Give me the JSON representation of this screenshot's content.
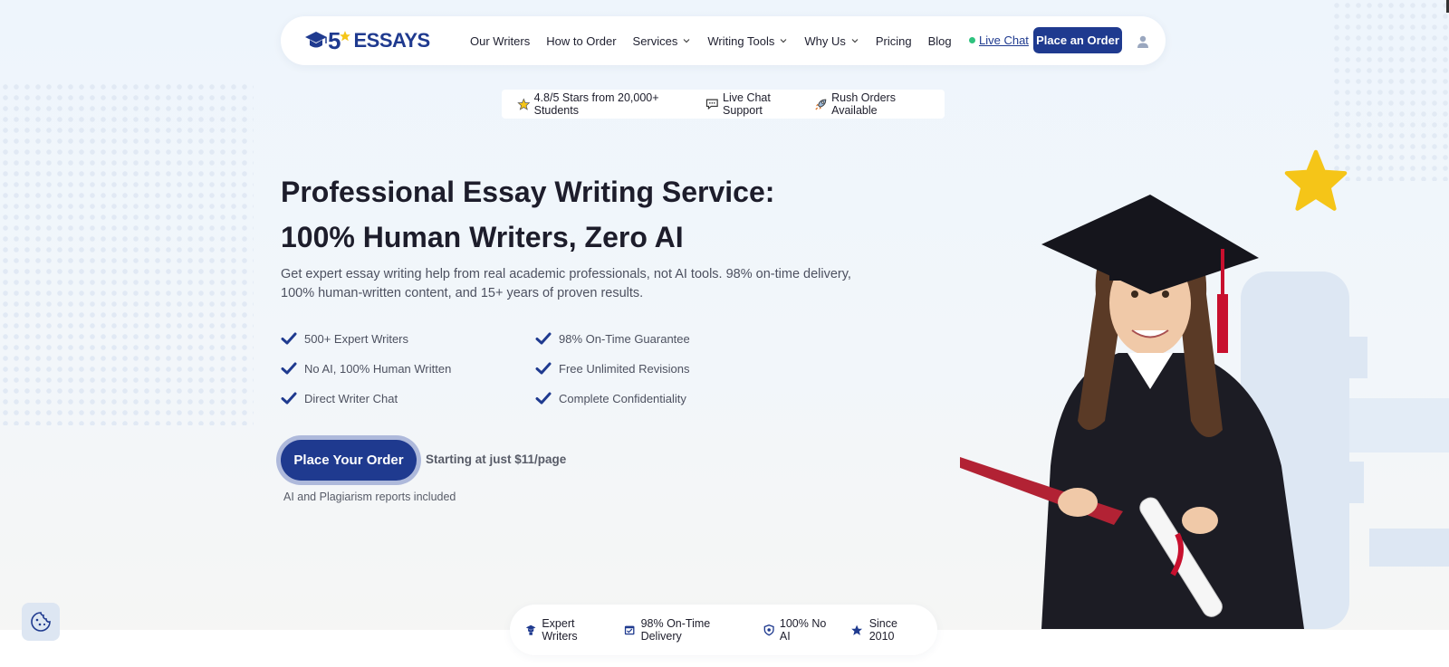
{
  "header": {
    "logo_number": "5",
    "logo_text": "ESSAYS",
    "nav": [
      {
        "label": "Our Writers",
        "dropdown": false
      },
      {
        "label": "How to Order",
        "dropdown": false
      },
      {
        "label": "Services",
        "dropdown": true
      },
      {
        "label": "Writing Tools",
        "dropdown": true
      },
      {
        "label": "Why Us",
        "dropdown": true
      },
      {
        "label": "Pricing",
        "dropdown": false
      },
      {
        "label": "Blog",
        "dropdown": false
      }
    ],
    "live_chat": "Live Chat",
    "order_button": "Place an Order"
  },
  "trust_bar": [
    {
      "icon": "star-icon",
      "text": "4.8/5 Stars from 20,000+ Students"
    },
    {
      "icon": "chat-bubble-icon",
      "text": "Live Chat Support"
    },
    {
      "icon": "rocket-icon",
      "text": "Rush Orders Available"
    }
  ],
  "hero": {
    "title_line1": "Professional Essay Writing Service:",
    "title_line2": "100% Human Writers, Zero AI",
    "subtitle": "Get expert essay writing help from real academic professionals, not AI tools. 98% on-time delivery, 100% human-written content, and 15+ years of proven results.",
    "features": [
      "500+ Expert Writers",
      "98% On-Time Guarantee",
      "No AI, 100% Human Written",
      "Free Unlimited Revisions",
      "Direct Writer Chat",
      "Complete Confidentiality"
    ],
    "cta_button": "Place Your Order",
    "cta_price": "Starting at just $11/page",
    "cta_note": "AI and Plagiarism reports included"
  },
  "bottom_bar": [
    {
      "icon": "graduate-icon",
      "text": "Expert Writers"
    },
    {
      "icon": "calendar-check-icon",
      "text": "98% On-Time Delivery"
    },
    {
      "icon": "shield-icon",
      "text": "100% No AI"
    },
    {
      "icon": "star-icon",
      "text": "Since 2010"
    }
  ],
  "colors": {
    "brand": "#1f3a8f",
    "accent_star": "#f5c518",
    "online": "#2ec27e"
  }
}
